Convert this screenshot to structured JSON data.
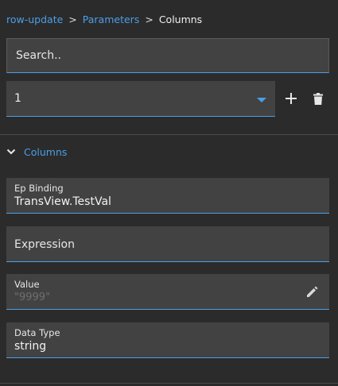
{
  "breadcrumb": {
    "items": [
      "row-update",
      "Parameters"
    ],
    "separator": ">",
    "current": "Columns"
  },
  "search": {
    "placeholder": "Search.."
  },
  "parameter_select": {
    "value": "1"
  },
  "toolbar": {
    "add_icon": "plus-icon",
    "delete_icon": "trash-icon"
  },
  "section": {
    "title": "Columns",
    "expanded": true
  },
  "fields": {
    "ep_binding": {
      "label": "Ep Binding",
      "value": "TransView.TestVal"
    },
    "expression": {
      "placeholder": "Expression"
    },
    "value": {
      "label": "Value",
      "value": "\"9999\""
    },
    "data_type": {
      "label": "Data Type",
      "value": "string"
    }
  },
  "colors": {
    "accent": "#4a9fe8",
    "background": "#2b2b2b",
    "field": "#424242"
  }
}
